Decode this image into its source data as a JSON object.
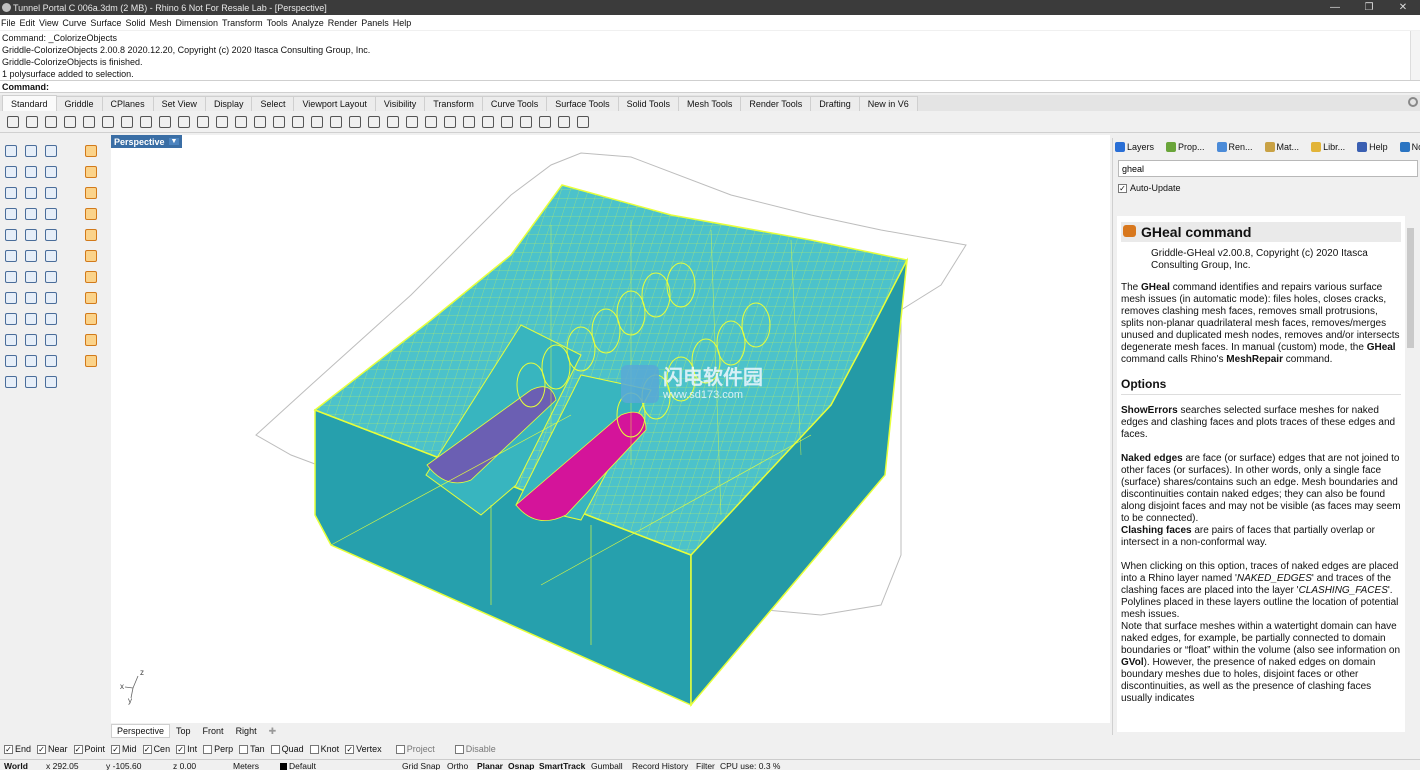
{
  "window": {
    "title": "Tunnel Portal C 006a.3dm (2 MB) - Rhino 6 Not For Resale Lab - [Perspective]",
    "min": "—",
    "max": "❐",
    "close": "✕"
  },
  "menu": [
    "File",
    "Edit",
    "View",
    "Curve",
    "Surface",
    "Solid",
    "Mesh",
    "Dimension",
    "Transform",
    "Tools",
    "Analyze",
    "Render",
    "Panels",
    "Help"
  ],
  "command_history": [
    "Command: _ColorizeObjects",
    "Griddle-ColorizeObjects 2.00.8 2020.12.20, Copyright (c) 2020 Itasca Consulting Group, Inc.",
    "Griddle-ColorizeObjects is finished.",
    "1 polysurface added to selection."
  ],
  "command_prompt": {
    "label": "Command:",
    "value": ""
  },
  "toolbar_tabs": [
    "Standard",
    "Griddle",
    "CPlanes",
    "Set View",
    "Display",
    "Select",
    "Viewport Layout",
    "Visibility",
    "Transform",
    "Curve Tools",
    "Surface Tools",
    "Solid Tools",
    "Mesh Tools",
    "Render Tools",
    "Drafting",
    "New in V6"
  ],
  "toolbar_active_tab": "Standard",
  "standard_icons": [
    "new-file-icon",
    "open-icon",
    "save-icon",
    "print-icon",
    "import-icon",
    "cut-icon",
    "copy-icon",
    "paste-icon",
    "undo-icon",
    "pan-icon",
    "rotate-view-icon",
    "zoom-icon",
    "zoom-window-icon",
    "zoom-extents-icon",
    "zoom-selected-icon",
    "rotate-icon",
    "viewport-layout-icon",
    "cplane-icon",
    "hide-icon",
    "show-icon",
    "lock-icon",
    "light-icon",
    "material-icon",
    "color-icon",
    "shaded-icon",
    "render-preview-icon",
    "render-icon",
    "analyze-icon",
    "options-icon",
    "tools-icon",
    "help-icon"
  ],
  "viewport": {
    "label": "Perspective",
    "axis": {
      "x": "x",
      "y": "y",
      "z": "z"
    },
    "colors": {
      "mesh": "#2aa7b3",
      "mesh_light": "#4fc8cf",
      "wire": "#e7ff3a",
      "purple": "#6b5fb3",
      "magenta": "#d4149a",
      "outline": "#b8b8b8"
    }
  },
  "watermark": {
    "line1": "闪电软件园",
    "line2": "www.sd173.com"
  },
  "view_tabs": [
    "Perspective",
    "Top",
    "Front",
    "Right"
  ],
  "view_tabs_active": "Perspective",
  "view_tabs_add": "✚",
  "panel_tabs": [
    {
      "label": "Layers",
      "color": "#2a6fd6"
    },
    {
      "label": "Prop...",
      "color": "#6aa53a"
    },
    {
      "label": "Ren...",
      "color": "#4b8bd8"
    },
    {
      "label": "Mat...",
      "color": "#c9a245"
    },
    {
      "label": "Libr...",
      "color": "#e2b438"
    },
    {
      "label": "Help",
      "color": "#3a5fb2"
    },
    {
      "label": "Noti...",
      "color": "#2a74c2"
    }
  ],
  "help_panel": {
    "search_value": "gheal",
    "auto_update_label": "Auto-Update",
    "auto_update_checked": true,
    "title": "GHeal command",
    "version": "Griddle-GHeal v2.00.8, Copyright (c) 2020 Itasca Consulting Group, Inc.",
    "intro_pre": "The ",
    "intro_cmd": "GHeal",
    "intro_mid": " command identifies and repairs various surface mesh issues (in automatic mode): files holes, closes cracks, removes clashing mesh faces, removes small protrusions, splits non-planar quadrilateral mesh faces, removes/merges unused and duplicated mesh nodes, removes and/or intersects degenerate mesh faces. In manual (custom) mode, the ",
    "intro_cmd2": "GHeal",
    "intro_mid2": " command calls Rhino's ",
    "intro_cmd3": "MeshRepair",
    "intro_end": " command.",
    "options_heading": "Options",
    "showerrors_term": "ShowErrors",
    "showerrors_text": " searches selected surface meshes for naked edges and clashing faces and plots traces of these edges and faces.",
    "naked_term": "Naked edges",
    "naked_text": " are face (or surface) edges that are not joined to other faces (or surfaces). In other words, only a single face (surface) shares/contains such an edge. Mesh boundaries and discontinuities contain naked edges; they can also be found along disjoint faces and may not be visible (as faces may seem to be connected).",
    "clash_term": "Clashing faces",
    "clash_text": " are pairs of faces that partially overlap or intersect in a non-conformal way.",
    "click_pre": "When clicking on this option, traces of naked edges are placed into a Rhino layer named '",
    "click_layer1": "NAKED_EDGES",
    "click_mid": "' and traces of the clashing faces are placed into the layer '",
    "click_layer2": "CLASHING_FACES",
    "click_end": "'. Polylines placed in these layers outline the location of potential mesh issues.",
    "note_pre": "Note that surface meshes within a watertight domain can have naked edges, for example, be partially connected to domain boundaries or “float” within the volume (also see information on ",
    "note_cmd": "GVol",
    "note_end": "). However, the presence of naked edges on domain boundary meshes due to holes, disjoint faces or other discontinuities, as well as the presence of clashing faces usually indicates"
  },
  "osnaps": [
    {
      "label": "End",
      "checked": true
    },
    {
      "label": "Near",
      "checked": true
    },
    {
      "label": "Point",
      "checked": true
    },
    {
      "label": "Mid",
      "checked": true
    },
    {
      "label": "Cen",
      "checked": true
    },
    {
      "label": "Int",
      "checked": true
    },
    {
      "label": "Perp",
      "checked": false
    },
    {
      "label": "Tan",
      "checked": false
    },
    {
      "label": "Quad",
      "checked": false
    },
    {
      "label": "Knot",
      "checked": false
    },
    {
      "label": "Vertex",
      "checked": true
    },
    {
      "label": "Project",
      "checked": false,
      "disabled": true
    },
    {
      "label": "Disable",
      "checked": false,
      "disabled": true
    }
  ],
  "status": {
    "cplane": "World",
    "x": "x 292.05",
    "y": "y -105.60",
    "z": "z 0.00",
    "units": "Meters",
    "layer": "Default",
    "grid_snap": "Grid Snap",
    "ortho": "Ortho",
    "planar": "Planar",
    "osnap": "Osnap",
    "smarttrack": "SmartTrack",
    "gumball": "Gumball",
    "record_history": "Record History",
    "filter": "Filter",
    "cpu": "CPU use: 0.3 %"
  }
}
